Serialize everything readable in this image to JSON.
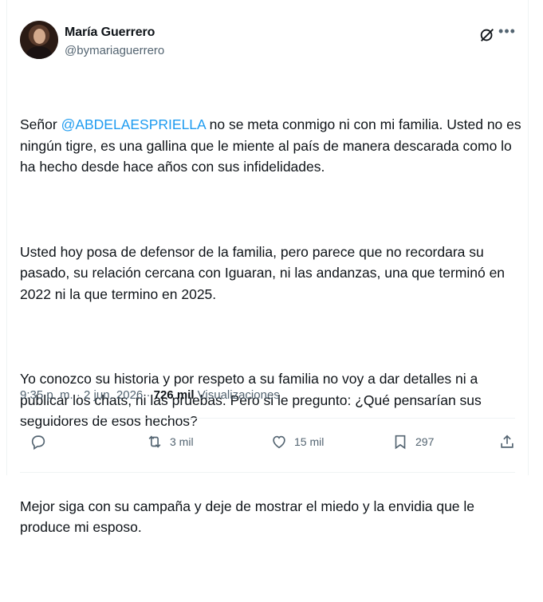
{
  "author": {
    "name": "María Guerrero",
    "handle": "@bymariaguerrero"
  },
  "tweet": {
    "p1_before": "Señor ",
    "p1_mention": "@ABDELAESPRIELLA",
    "p1_after": " no se meta conmigo ni con mi familia. Usted no es ningún tigre, es una gallina que le miente al país de manera descarada como lo ha hecho desde hace años con sus infidelidades.",
    "p2": "Usted hoy posa de defensor de la familia, pero parece que no recordara su pasado, su relación cercana con Iguaran, ni las andanzas, una que terminó en 2022 ni la que termino en 2025.",
    "p3": "Yo conozco su historia y por respeto a su familia no voy a dar detalles ni a publicar los chats, ni las pruebas. Pero si le pregunto: ¿Qué pensarían sus seguidores de esos hechos?",
    "p4": "Mejor siga con su campaña y deje de mostrar el miedo y la envidia que le produce mi esposo."
  },
  "meta": {
    "time": "9:35 p. m.",
    "sep1": " · ",
    "date": "2 jun. 2026",
    "sep2": " · ",
    "views_count": "726 mil",
    "views_label": " Visualizaciones"
  },
  "actions": {
    "reply_icon": "reply-icon",
    "retweet_icon": "retweet-icon",
    "retweets": "3 mil",
    "like_icon": "heart-icon",
    "likes": "15 mil",
    "bookmark_icon": "bookmark-icon",
    "bookmarks": "297",
    "share_icon": "share-icon"
  },
  "colors": {
    "accent": "#1d9bf0",
    "text": "#0f1419",
    "muted": "#536471"
  }
}
